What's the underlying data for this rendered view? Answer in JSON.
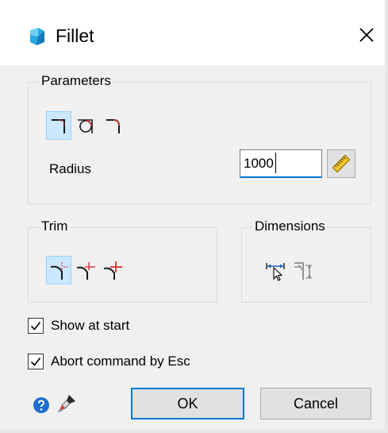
{
  "window": {
    "title": "Fillet",
    "close_glyph": "✕"
  },
  "parameters": {
    "legend": "Parameters",
    "modes": [
      "fillet-arc",
      "fillet-circle",
      "fillet-chamfer"
    ],
    "selected_mode": 0,
    "radius_label": "Radius",
    "radius_value": "1000"
  },
  "trim": {
    "legend": "Trim",
    "modes": [
      "trim-both",
      "trim-first",
      "trim-none"
    ],
    "selected_mode": 0
  },
  "dimensions": {
    "legend": "Dimensions",
    "icons": [
      "dimension-pick-icon",
      "dimension-radius-icon"
    ]
  },
  "options": {
    "show_at_start": {
      "label": "Show at start",
      "checked": true
    },
    "abort_by_esc": {
      "label": "Abort command by Esc",
      "checked": true
    }
  },
  "buttons": {
    "ok": "OK",
    "cancel": "Cancel"
  },
  "colors": {
    "accent": "#0078d7",
    "selected_bg": "#cce8ff",
    "app_icon": "#1e9fd8",
    "curve_red": "#d83030"
  }
}
